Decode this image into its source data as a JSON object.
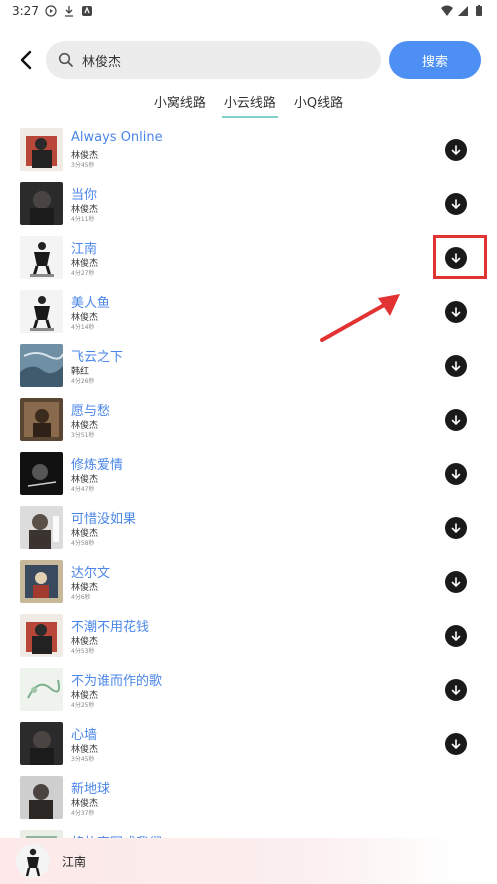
{
  "status_bar": {
    "time": "3:27"
  },
  "search": {
    "query": "林俊杰",
    "button_label": "搜索"
  },
  "tabs": [
    {
      "label": "小窝线路",
      "active": false
    },
    {
      "label": "小云线路",
      "active": true
    },
    {
      "label": "小Q线路",
      "active": false
    }
  ],
  "songs": [
    {
      "title": "Always Online",
      "artist": "林俊杰",
      "duration": "3分45秒"
    },
    {
      "title": "当你",
      "artist": "林俊杰",
      "duration": "4分11秒"
    },
    {
      "title": "江南",
      "artist": "林俊杰",
      "duration": "4分27秒"
    },
    {
      "title": "美人鱼",
      "artist": "林俊杰",
      "duration": "4分14秒"
    },
    {
      "title": "飞云之下",
      "artist": "韩红",
      "duration": "4分26秒"
    },
    {
      "title": "愿与愁",
      "artist": "林俊杰",
      "duration": "3分51秒"
    },
    {
      "title": "修炼爱情",
      "artist": "林俊杰",
      "duration": "4分47秒"
    },
    {
      "title": "可惜没如果",
      "artist": "林俊杰",
      "duration": "4分58秒"
    },
    {
      "title": "达尔文",
      "artist": "林俊杰",
      "duration": "4分6秒"
    },
    {
      "title": "不潮不用花钱",
      "artist": "林俊杰",
      "duration": "4分53秒"
    },
    {
      "title": "不为谁而作的歌",
      "artist": "林俊杰",
      "duration": "4分25秒"
    },
    {
      "title": "心墙",
      "artist": "林俊杰",
      "duration": "3分45秒"
    },
    {
      "title": "新地球",
      "artist": "林俊杰",
      "duration": "4分37秒"
    },
    {
      "title": "将故事写成我们",
      "artist": "",
      "duration": ""
    }
  ],
  "mini_player": {
    "title": "江南"
  },
  "colors": {
    "accent": "#4d8ff3",
    "title_blue": "#4a86e8",
    "highlight_red": "#e23232"
  }
}
